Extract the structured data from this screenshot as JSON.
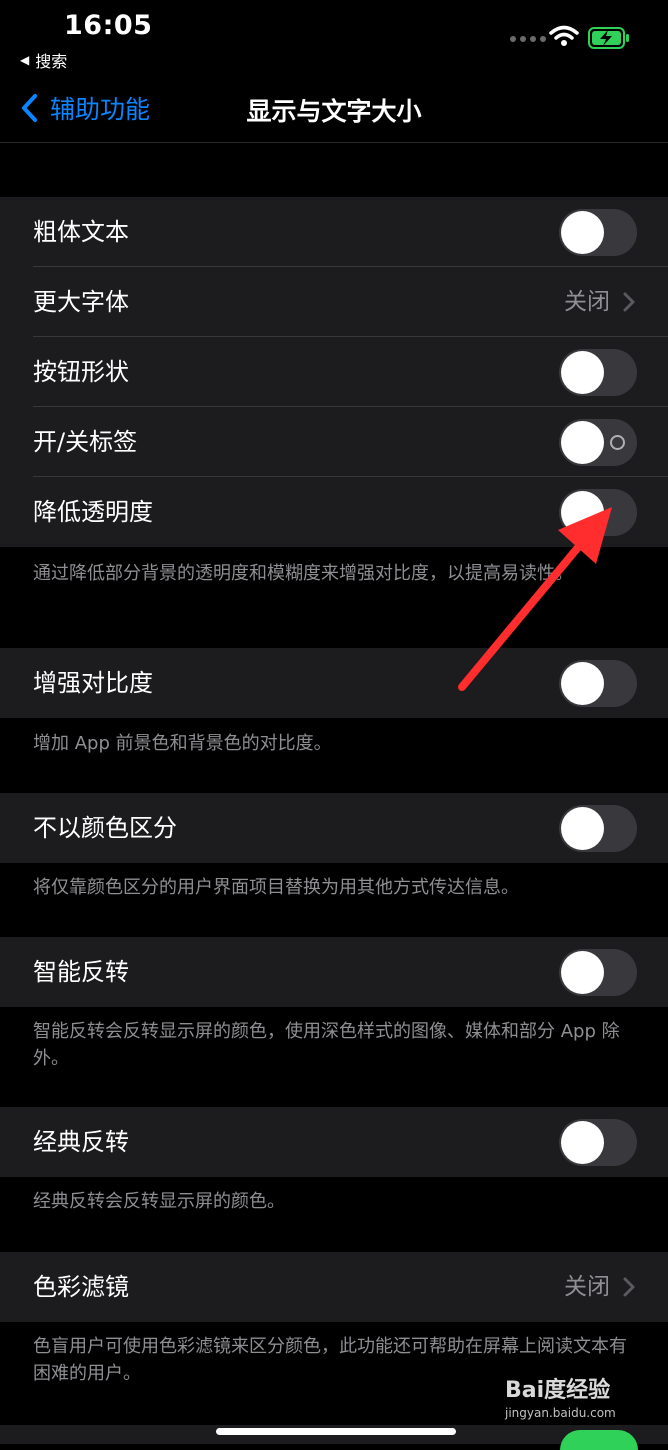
{
  "status_bar": {
    "time": "16:05",
    "back_app": "搜索"
  },
  "nav": {
    "back_label": "辅助功能",
    "title": "显示与文字大小"
  },
  "rows": [
    {
      "label": "粗体文本",
      "type": "toggle",
      "on": false
    },
    {
      "label": "更大字体",
      "type": "link",
      "value": "关闭"
    },
    {
      "label": "按钮形状",
      "type": "toggle",
      "on": false
    },
    {
      "label": "开/关标签",
      "type": "toggle",
      "on": false
    },
    {
      "label": "降低透明度",
      "type": "toggle",
      "on": false
    },
    {
      "label": "增强对比度",
      "type": "toggle",
      "on": false
    },
    {
      "label": "不以颜色区分",
      "type": "toggle",
      "on": false
    },
    {
      "label": "智能反转",
      "type": "toggle",
      "on": false
    },
    {
      "label": "经典反转",
      "type": "toggle",
      "on": false
    },
    {
      "label": "色彩滤镜",
      "type": "link",
      "value": "关闭"
    }
  ],
  "footers": [
    "通过降低部分背景的透明度和模糊度来增强对比度，以提高易读性。",
    "增加 App 前景色和背景色的对比度。",
    "将仅靠颜色区分的用户界面项目替换为用其他方式传达信息。",
    "智能反转会反转显示屏的颜色，使用深色样式的图像、媒体和部分 App 除外。",
    "经典反转会反转显示屏的颜色。",
    "色盲用户可使用色彩滤镜来区分颜色，此功能还可帮助在屏幕上阅读文本有困难的用户。"
  ],
  "watermark": {
    "brand": "Bai度经验",
    "url": "jingyan.baidu.com"
  },
  "colors": {
    "accent": "#0a84ff",
    "annotation": "#ff2d2d",
    "battery": "#30d158"
  }
}
